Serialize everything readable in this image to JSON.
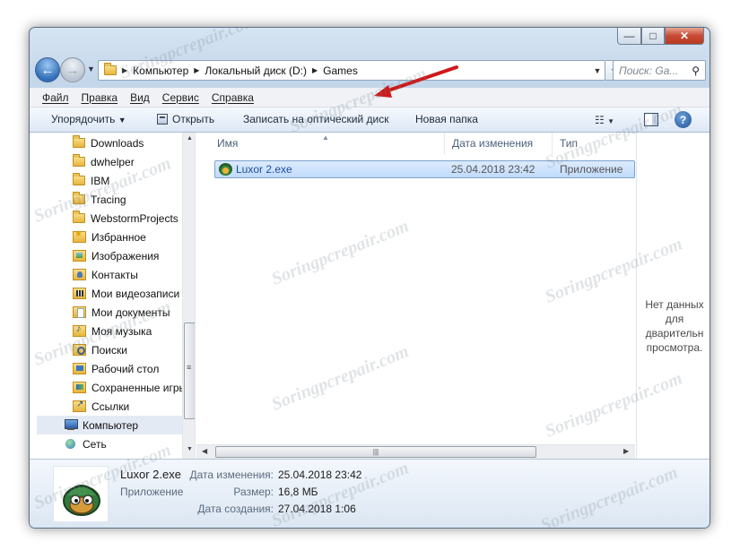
{
  "window": {
    "caption_buttons": {
      "minimize": "—",
      "maximize": "□",
      "close": "✕"
    }
  },
  "address_bar": {
    "crumbs": [
      "Компьютер",
      "Локальный диск (D:)",
      "Games"
    ],
    "search_placeholder": "Поиск: Ga...",
    "back_icon": "arrow-left-icon",
    "forward_icon": "arrow-right-icon"
  },
  "menu": {
    "items": [
      "Файл",
      "Правка",
      "Вид",
      "Сервис",
      "Справка"
    ]
  },
  "toolbar": {
    "organize": "Упорядочить",
    "open": "Открыть",
    "burn": "Записать на оптический диск",
    "new_folder": "Новая папка"
  },
  "nav_pane": {
    "items": [
      {
        "label": "Downloads",
        "icon": "folder-icon"
      },
      {
        "label": "dwhelper",
        "icon": "folder-icon"
      },
      {
        "label": "IBM",
        "icon": "folder-icon"
      },
      {
        "label": "Tracing",
        "icon": "folder-icon"
      },
      {
        "label": "WebstormProjects",
        "icon": "folder-icon"
      },
      {
        "label": "Избранное",
        "icon": "favorites-folder-icon"
      },
      {
        "label": "Изображения",
        "icon": "pictures-folder-icon"
      },
      {
        "label": "Контакты",
        "icon": "contacts-folder-icon"
      },
      {
        "label": "Мои видеозаписи",
        "icon": "videos-folder-icon"
      },
      {
        "label": "Мои документы",
        "icon": "documents-folder-icon"
      },
      {
        "label": "Моя музыка",
        "icon": "music-folder-icon"
      },
      {
        "label": "Поиски",
        "icon": "searches-folder-icon"
      },
      {
        "label": "Рабочий стол",
        "icon": "desktop-folder-icon"
      },
      {
        "label": "Сохраненные игры",
        "icon": "saved-games-folder-icon"
      },
      {
        "label": "Ссылки",
        "icon": "links-folder-icon"
      },
      {
        "label": "Компьютер",
        "icon": "computer-icon"
      },
      {
        "label": "Сеть",
        "icon": "network-icon"
      }
    ]
  },
  "file_list": {
    "columns": [
      "Имя",
      "Дата изменения",
      "Тип"
    ],
    "rows": [
      {
        "name": "Luxor 2.exe",
        "modified": "25.04.2018 23:42",
        "type": "Приложение"
      }
    ]
  },
  "preview_pane": {
    "text": "Нет данных\nдля\nдварительн\nпросмотра."
  },
  "details_pane": {
    "name": "Luxor 2.exe",
    "type": "Приложение",
    "modified_label": "Дата изменения:",
    "modified_value": "25.04.2018 23:42",
    "size_label": "Размер:",
    "size_value": "16,8 МБ",
    "created_label": "Дата создания:",
    "created_value": "27.04.2018 1:06"
  },
  "watermark": "Soringpcrepair.com",
  "colors": {
    "selection_fill": "#c9e0fc",
    "selection_border": "#7da2ce",
    "annotation_arrow": "#d01818"
  }
}
